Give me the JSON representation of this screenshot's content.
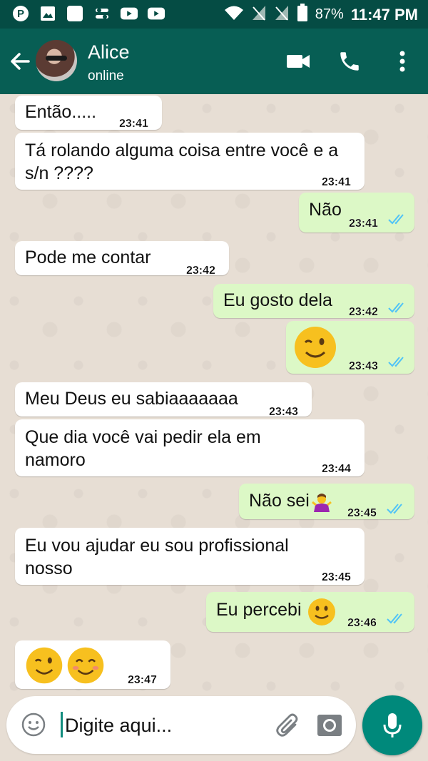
{
  "status_bar": {
    "battery": "87%",
    "time": "11:47 PM",
    "icons": [
      "pinterest-icon",
      "gallery-icon",
      "blank-app-icon",
      "toggle-app-icon",
      "youtube-icon",
      "youtube-icon",
      "wifi-icon",
      "no-signal-icon",
      "no-signal-icon",
      "battery-icon"
    ]
  },
  "header": {
    "contact_name": "Alice",
    "contact_status": "online",
    "icons": [
      "back-arrow-icon",
      "video-call-icon",
      "phone-icon",
      "more-vert-icon"
    ]
  },
  "messages": [
    {
      "dir": "in",
      "text": "Então.....",
      "time": "23:41"
    },
    {
      "dir": "in",
      "text": "Tá rolando alguma coisa entre você e a s/n ????",
      "time": "23:41"
    },
    {
      "dir": "out",
      "text": "Não",
      "time": "23:41"
    },
    {
      "dir": "in",
      "text": "Pode me contar",
      "time": "23:42"
    },
    {
      "dir": "out",
      "text": "Eu gosto dela",
      "time": "23:42"
    },
    {
      "dir": "out",
      "text": "",
      "emoji": [
        "winking-face"
      ],
      "time": "23:43"
    },
    {
      "dir": "in",
      "text": "Meu Deus eu sabiaaaaaaa",
      "time": "23:43"
    },
    {
      "dir": "in",
      "text": "Que dia você vai pedir ela em namoro",
      "time": "23:44"
    },
    {
      "dir": "out",
      "text": "Não sei",
      "emoji": [
        "person-shrugging"
      ],
      "time": "23:45"
    },
    {
      "dir": "in",
      "text": "Eu vou ajudar eu sou profissional nosso",
      "time": "23:45"
    },
    {
      "dir": "out",
      "text": "Eu percebi",
      "emoji": [
        "slightly-smiling-face"
      ],
      "time": "23:46"
    },
    {
      "dir": "in",
      "text": "",
      "emoji": [
        "winking-face",
        "smiling-face"
      ],
      "time": "23:47"
    }
  ],
  "composer": {
    "placeholder": "Digite aqui...",
    "icons": [
      "emoji-icon",
      "attach-icon",
      "camera-icon",
      "mic-icon"
    ]
  },
  "colors": {
    "status_bar": "#054c44",
    "header": "#075e54",
    "outgoing_bubble": "#dcf8c6",
    "incoming_bubble": "#ffffff",
    "read_ticks": "#4fc3f7",
    "mic_button": "#00897b"
  }
}
